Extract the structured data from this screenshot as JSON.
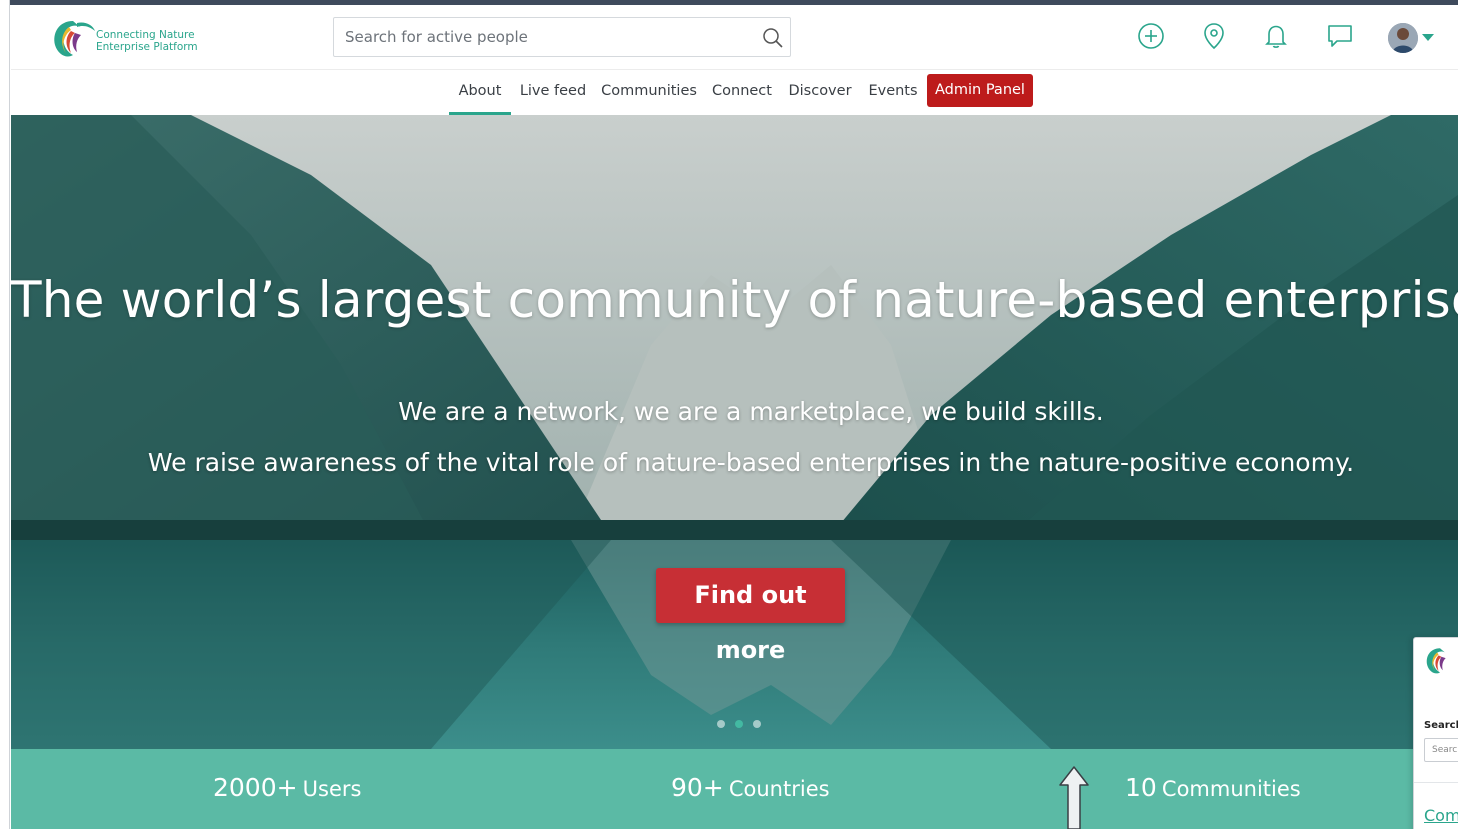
{
  "header": {
    "logo_line1": "Connecting Nature",
    "logo_line2": "Enterprise Platform",
    "search_placeholder": "Search for active people",
    "icons": [
      "add-icon",
      "location-pin-icon",
      "bell-icon",
      "chat-icon",
      "avatar",
      "caret-down-icon"
    ]
  },
  "nav": {
    "items": [
      {
        "label": "About",
        "active": true
      },
      {
        "label": "Live feed"
      },
      {
        "label": "Communities"
      },
      {
        "label": "Connect"
      },
      {
        "label": "Discover"
      },
      {
        "label": "Events"
      }
    ],
    "admin_label": "Admin Panel"
  },
  "hero": {
    "title": "The world’s largest community of nature-based enterprises",
    "line1": "We are a network, we are a marketplace, we build skills.",
    "line2": "We raise awareness of the vital role of nature-based enterprises in the nature-positive economy.",
    "cta": "Find out more",
    "slides": 3,
    "active_slide": 2
  },
  "stats": [
    {
      "number": "2000+",
      "label": "Users"
    },
    {
      "number": "90+",
      "label": "Countries"
    },
    {
      "number": "10",
      "label": "Communities"
    }
  ],
  "popup_peek": {
    "search_label": "Search f",
    "input_placeholder": "Searc",
    "link_text": "Com"
  },
  "colors": {
    "accent": "#2aa58c",
    "admin": "#bd1b1b",
    "cta": "#c72f35",
    "stats_bar": "#5bbaa5"
  }
}
